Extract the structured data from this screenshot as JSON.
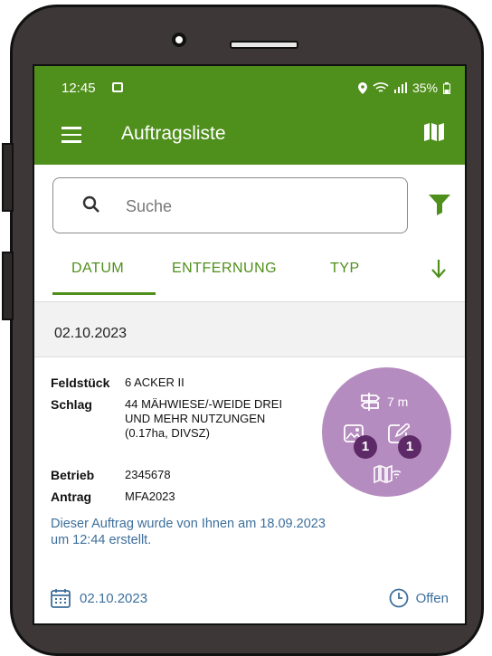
{
  "status_bar": {
    "time": "12:45",
    "battery": "35%"
  },
  "app_bar": {
    "title": "Auftragsliste"
  },
  "search": {
    "placeholder": "Suche"
  },
  "tabs": [
    {
      "label": "DATUM",
      "active": true
    },
    {
      "label": "ENTFERNUNG",
      "active": false
    },
    {
      "label": "TYP",
      "active": false
    }
  ],
  "group": {
    "date": "02.10.2023"
  },
  "card": {
    "fields": [
      {
        "key": "Feldstück",
        "value": "6  ACKER II"
      },
      {
        "key": "Schlag",
        "value": "44  MÄHWIESE/-WEIDE DREI UND MEHR NUTZUNGEN (0.17ha, DIVSZ)"
      },
      {
        "key": "Betrieb",
        "value": "2345678"
      },
      {
        "key": "Antrag",
        "value": "MFA2023"
      }
    ],
    "distance": "7 m",
    "photo_count": "1",
    "edit_count": "1",
    "note": "Dieser Auftrag wurde von Ihnen am 18.09.2023 um 12:44 erstellt.",
    "footer_date": "02.10.2023",
    "footer_status": "Offen"
  },
  "colors": {
    "primary_green": "#4f8f1b",
    "circle_purple": "#b58cbf",
    "badge_purple": "#5d2a67",
    "link_blue": "#3d6f9c"
  },
  "icons": [
    "image-icon",
    "location-icon",
    "wifi-icon",
    "signal-icon",
    "battery-icon",
    "menu-icon",
    "map-icon",
    "search-icon",
    "filter-icon",
    "sort-down-icon",
    "signpost-icon",
    "photo-icon",
    "edit-icon",
    "map-wifi-icon",
    "calendar-icon",
    "clock-icon"
  ]
}
